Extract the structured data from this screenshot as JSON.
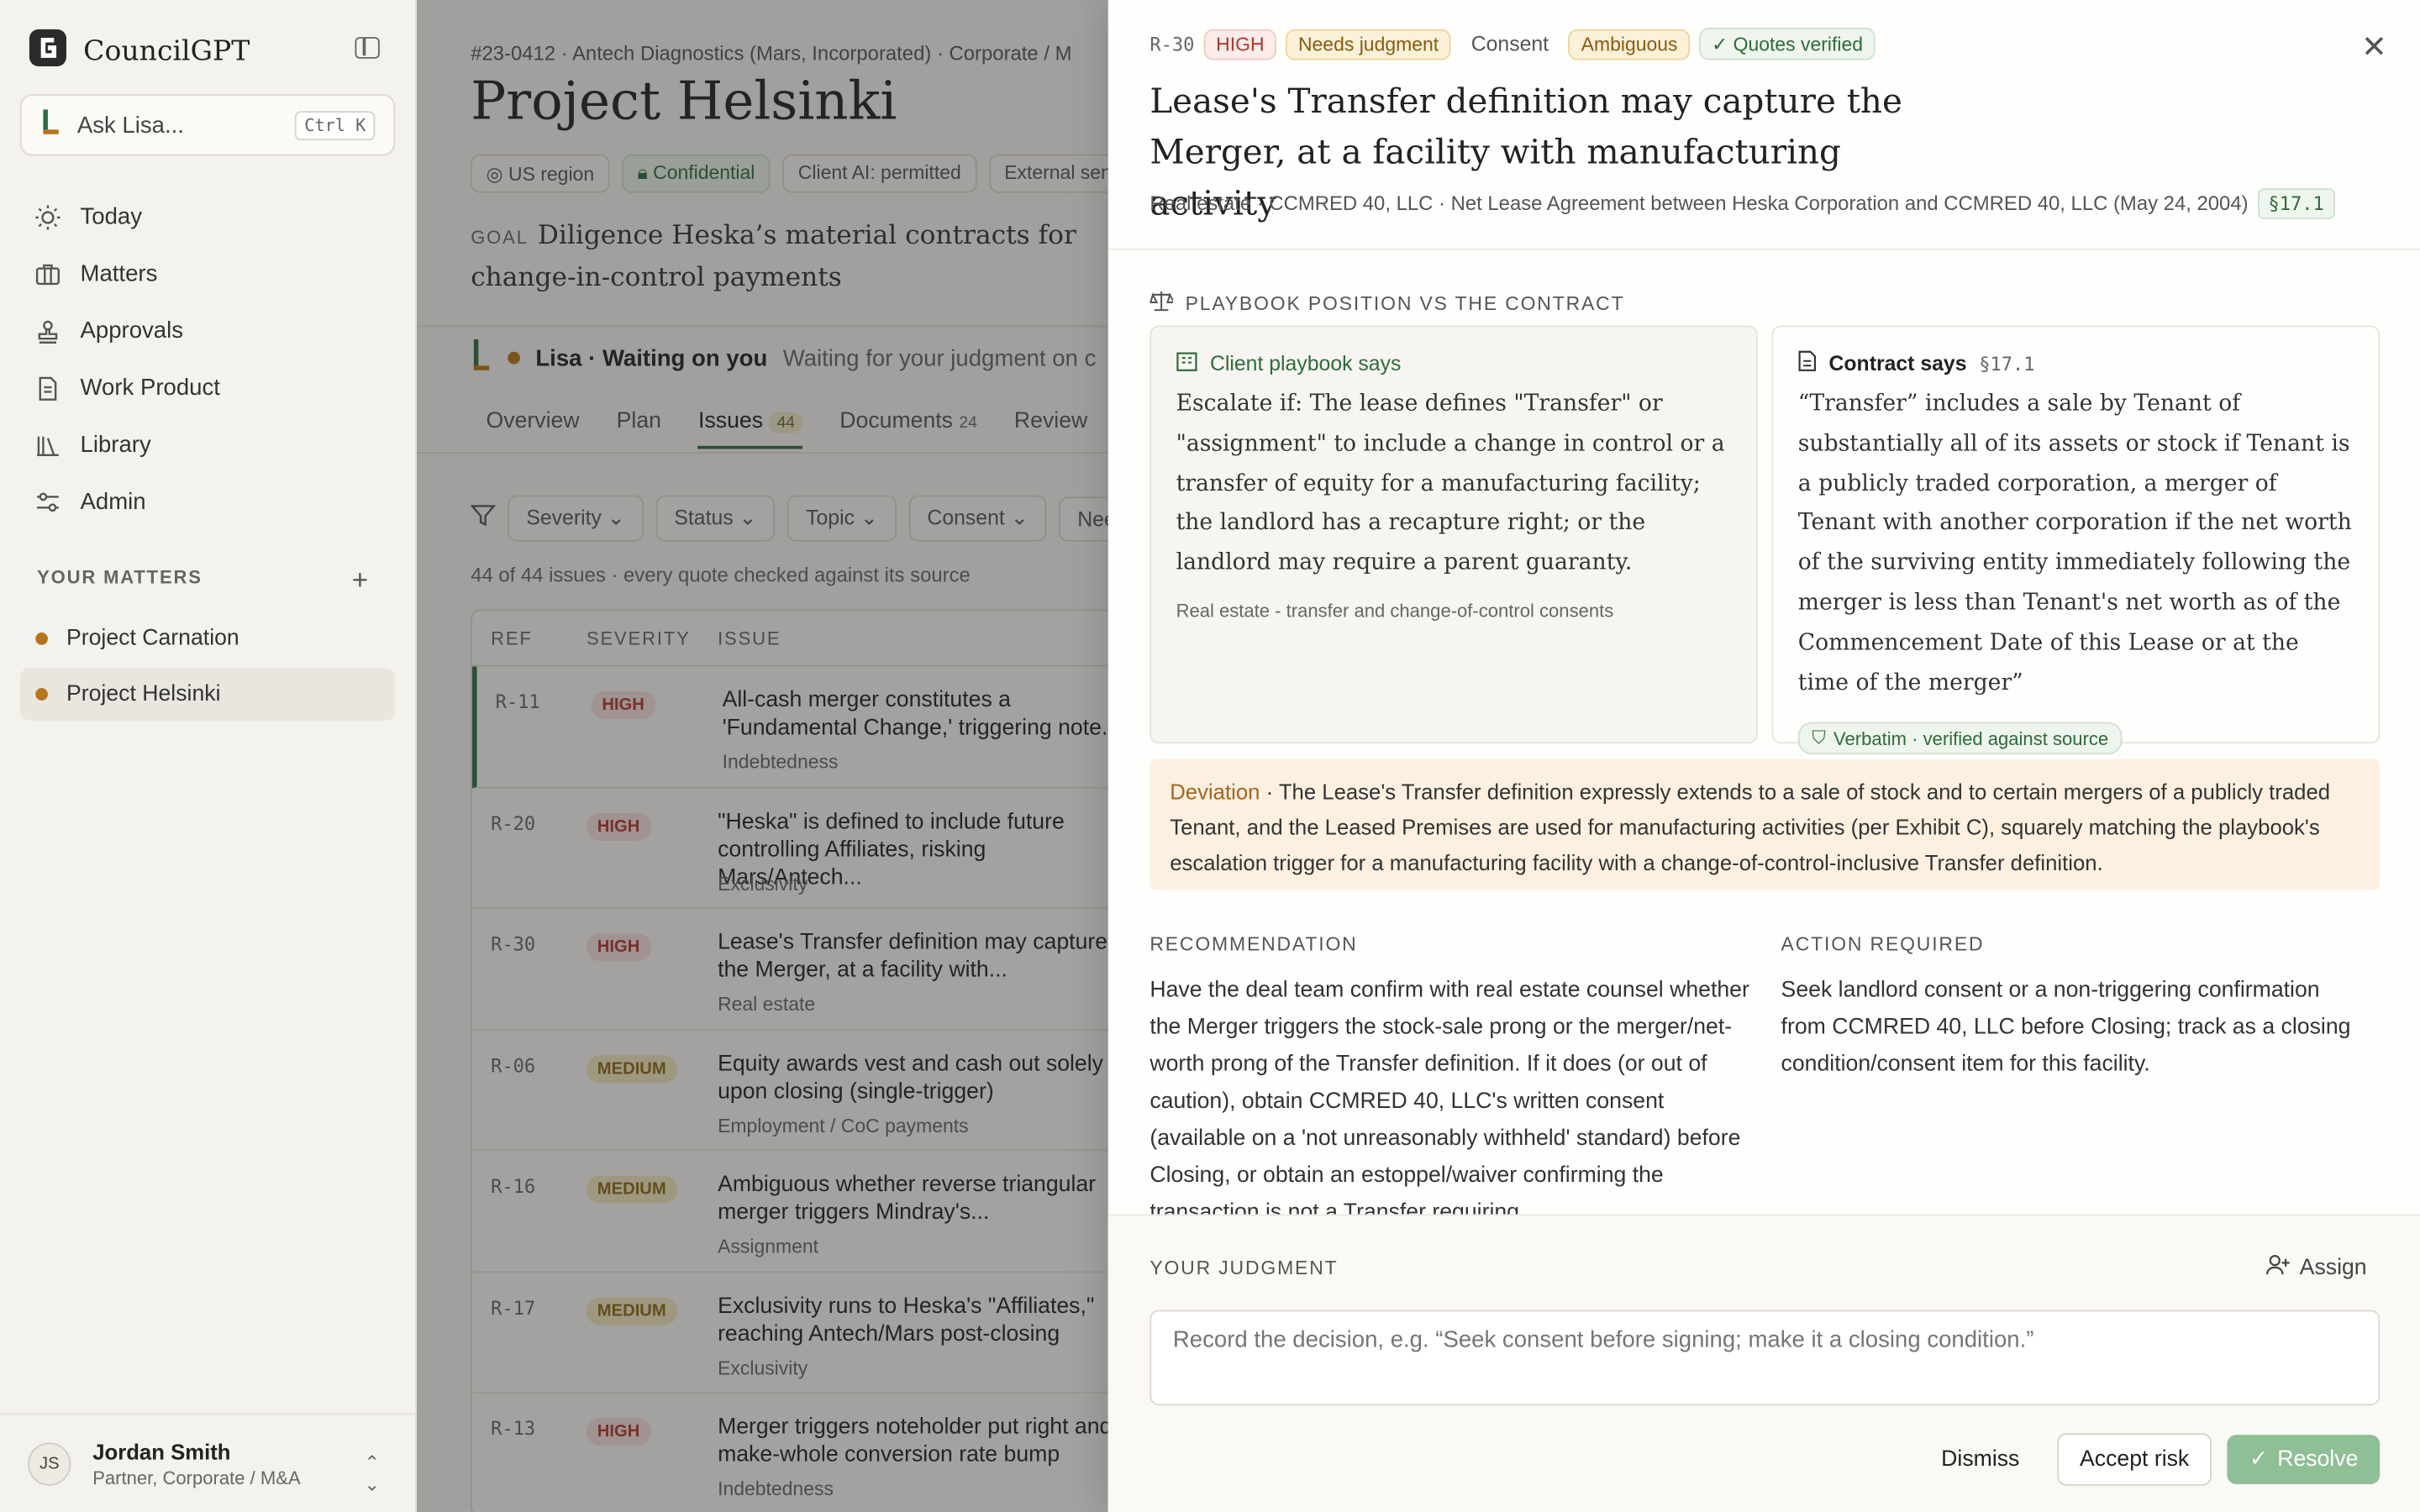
{
  "sidebar": {
    "brand": "CouncilGPT",
    "ask_label": "Ask Lisa...",
    "ask_shortcut": "Ctrl K",
    "nav": [
      {
        "label": "Today",
        "icon": "sun-icon"
      },
      {
        "label": "Matters",
        "icon": "briefcase-icon"
      },
      {
        "label": "Approvals",
        "icon": "stamp-icon"
      },
      {
        "label": "Work Product",
        "icon": "document-icon"
      },
      {
        "label": "Library",
        "icon": "books-icon"
      },
      {
        "label": "Admin",
        "icon": "sliders-icon"
      }
    ],
    "matters_label": "YOUR MATTERS",
    "matters": [
      "Project Carnation",
      "Project Helsinki"
    ],
    "user": {
      "initials": "JS",
      "name": "Jordan Smith",
      "role": "Partner, Corporate / M&A"
    }
  },
  "main": {
    "crumbs": "#23-0412  ·  Antech Diagnostics (Mars, Incorporated)  ·  Corporate / M",
    "title": "Project Helsinki",
    "chips": [
      "US region",
      "Confidential",
      "Client AI: permitted",
      "External send"
    ],
    "goal_label": "GOAL",
    "goal": "Diligence Heska’s material contracts for change-in-control payments",
    "status_agent": "Lisa · Waiting on you",
    "status_text": "Waiting for your judgment on c",
    "tabs": [
      {
        "label": "Overview",
        "badge": ""
      },
      {
        "label": "Plan",
        "badge": ""
      },
      {
        "label": "Issues",
        "badge": "44"
      },
      {
        "label": "Documents",
        "badge": "24"
      },
      {
        "label": "Review",
        "badge": ""
      }
    ],
    "filters": [
      "Severity",
      "Status",
      "Topic",
      "Consent",
      "Need"
    ],
    "count": "44 of 44 issues · every quote checked against its source",
    "columns": [
      "REF",
      "SEVERITY",
      "ISSUE"
    ],
    "rows": [
      {
        "ref": "R-11",
        "sev": "HIGH",
        "title": "All-cash merger constitutes a 'Fundamental Change,' triggering note...",
        "topic": "Indebtedness"
      },
      {
        "ref": "R-20",
        "sev": "HIGH",
        "title": "\"Heska\" is defined to include future controlling Affiliates, risking Mars/Antech...",
        "topic": "Exclusivity"
      },
      {
        "ref": "R-30",
        "sev": "HIGH",
        "title": "Lease's Transfer definition may capture the Merger, at a facility with...",
        "topic": "Real estate"
      },
      {
        "ref": "R-06",
        "sev": "MEDIUM",
        "title": "Equity awards vest and cash out solely upon closing (single-trigger)",
        "topic": "Employment / CoC payments"
      },
      {
        "ref": "R-16",
        "sev": "MEDIUM",
        "title": "Ambiguous whether reverse triangular merger triggers Mindray's...",
        "topic": "Assignment"
      },
      {
        "ref": "R-17",
        "sev": "MEDIUM",
        "title": "Exclusivity runs to Heska's \"Affiliates,\" reaching Antech/Mars post-closing",
        "topic": "Exclusivity"
      },
      {
        "ref": "R-13",
        "sev": "HIGH",
        "title": "Merger triggers noteholder put right and make-whole conversion rate bump",
        "topic": "Indebtedness"
      }
    ]
  },
  "panel": {
    "ref": "R-30",
    "severity": "HIGH",
    "needs": "Needs judgment",
    "category": "Consent",
    "ambiguity": "Ambiguous",
    "verified": "Quotes verified",
    "title": "Lease's Transfer definition may capture the Merger, at a facility with manufacturing activity",
    "meta": "Real estate  ·  CCMRED 40, LLC  ·  Net Lease Agreement between Heska Corporation and CCMRED 40, LLC (May 24, 2004)",
    "section_ref": "§17.1",
    "pb_heading": "PLAYBOOK POSITION VS THE CONTRACT",
    "playbook_title": "Client playbook says",
    "playbook_text": "Escalate if: The lease defines \"Transfer\" or \"assignment\" to include a change in control or a transfer of equity for a manufacturing facility; the landlord has a recapture right; or the landlord may require a parent guaranty.",
    "playbook_source": "Real estate - transfer and change-of-control consents",
    "contract_title": "Contract says",
    "contract_ref": "§17.1",
    "contract_text": "“Transfer” includes a sale by Tenant of substantially all of its assets or stock if Tenant is a publicly traded corporation, a merger of Tenant with another corporation if the net worth of the surviving entity immediately following the merger is less than Tenant's net worth as of the Commencement Date of this Lease or at the time of the merger”",
    "verbatim": "Verbatim · verified against source",
    "deviation_label": "Deviation",
    "deviation_text": " · The Lease's Transfer definition expressly extends to a sale of stock and to certain mergers of a publicly traded Tenant, and the Leased Premises are used for manufacturing activities (per Exhibit C), squarely matching the playbook's escalation trigger for a manufacturing facility with a change-of-control-inclusive Transfer definition.",
    "rec_heading": "RECOMMENDATION",
    "rec_text": "Have the deal team confirm with real estate counsel whether the Merger triggers the stock-sale prong or the merger/net-worth prong of the Transfer definition. If it does (or out of caution), obtain CCMRED 40, LLC's written consent (available on a 'not unreasonably withheld' standard) before Closing, or obtain an estoppel/waiver confirming the transaction is not a Transfer requiring",
    "action_heading": "ACTION REQUIRED",
    "action_text": "Seek landlord consent or a non-triggering confirmation from CCMRED 40, LLC before Closing; track as a closing condition/consent item for this facility.",
    "judgment_heading": "YOUR JUDGMENT",
    "assign": "Assign",
    "judgment_placeholder": "Record the decision, e.g. “Seek consent before signing; make it a closing condition.”",
    "dismiss": "Dismiss",
    "accept": "Accept risk",
    "resolve": "Resolve"
  },
  "colors": {
    "accent": "#2f6b3c",
    "high": "#b0382d",
    "medium": "#8a6a10",
    "matter_dot": "#b8741a"
  }
}
